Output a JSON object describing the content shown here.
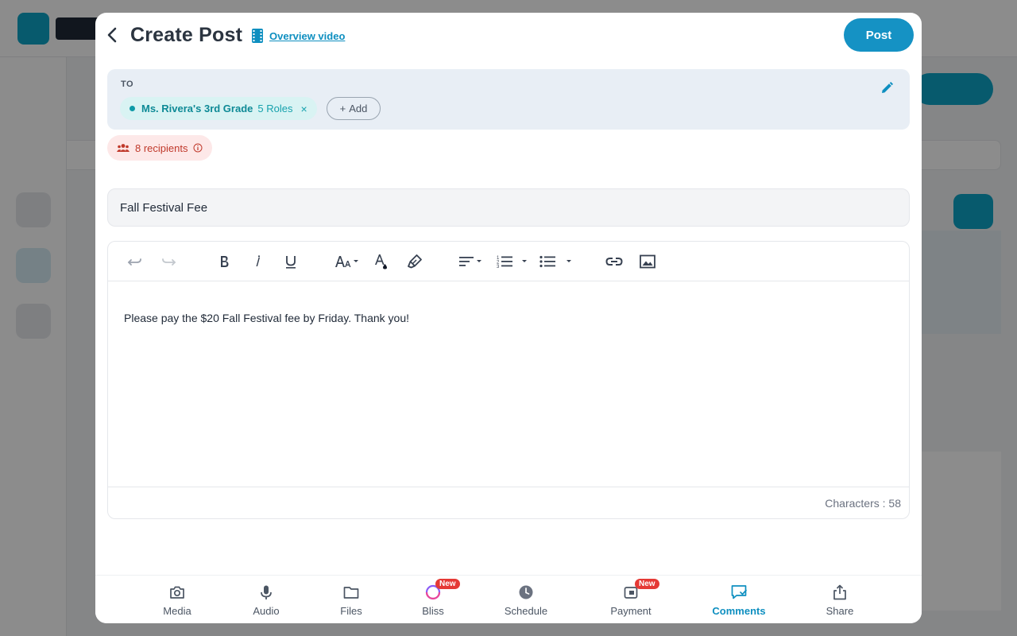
{
  "modal": {
    "title": "Create Post",
    "overview_link": "Overview video",
    "post_button": "Post"
  },
  "to": {
    "label": "TO",
    "chip": {
      "name": "Ms. Rivera's 3rd Grade",
      "roles": "5 Roles",
      "close": "×"
    },
    "add_label": "Add",
    "add_plus": "+"
  },
  "recipients": {
    "label": "8 recipients"
  },
  "subject": {
    "value": "Fall Festival Fee"
  },
  "editor": {
    "body": "Please pay the $20 Fall Festival fee by Friday. Thank you!",
    "characters": "Characters : 58",
    "toolbar": [
      "undo-icon",
      "redo-icon",
      "bold-icon",
      "italic-icon",
      "underline-icon",
      "font-size-icon",
      "text-color-icon",
      "highlight-icon",
      "align-icon",
      "numbered-list-icon",
      "bullet-list-icon",
      "link-icon",
      "image-icon"
    ]
  },
  "bottom_bar": {
    "items": [
      {
        "label": "Media",
        "icon": "camera-icon"
      },
      {
        "label": "Audio",
        "icon": "microphone-icon"
      },
      {
        "label": "Files",
        "icon": "folder-icon"
      },
      {
        "label": "Bliss",
        "icon": "bliss-icon",
        "badge": "New"
      },
      {
        "label": "Schedule",
        "icon": "clock-icon"
      },
      {
        "label": "Payment",
        "icon": "payment-icon",
        "badge": "New"
      },
      {
        "label": "Comments",
        "icon": "comments-icon",
        "active": true
      },
      {
        "label": "Share",
        "icon": "share-icon"
      }
    ]
  },
  "colors": {
    "accent": "#1592c4",
    "chip_bg": "#d9f3f3",
    "recipient_bg": "#fde8e8",
    "badge": "#e53935"
  }
}
